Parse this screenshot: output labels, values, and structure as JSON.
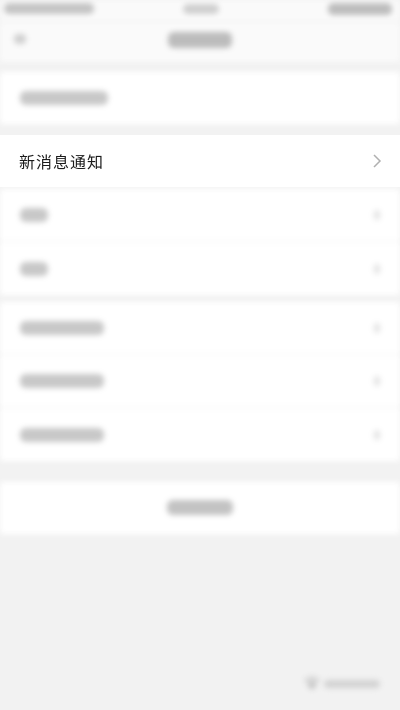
{
  "settings": {
    "new_message_notification_label": "新消息通知"
  },
  "icons": {
    "row_chevron": "chevron-right-icon"
  },
  "colors": {
    "background": "#f2f2f2",
    "row_background": "#ffffff",
    "text": "#1b1b1b",
    "chevron": "#b0b0b0"
  }
}
